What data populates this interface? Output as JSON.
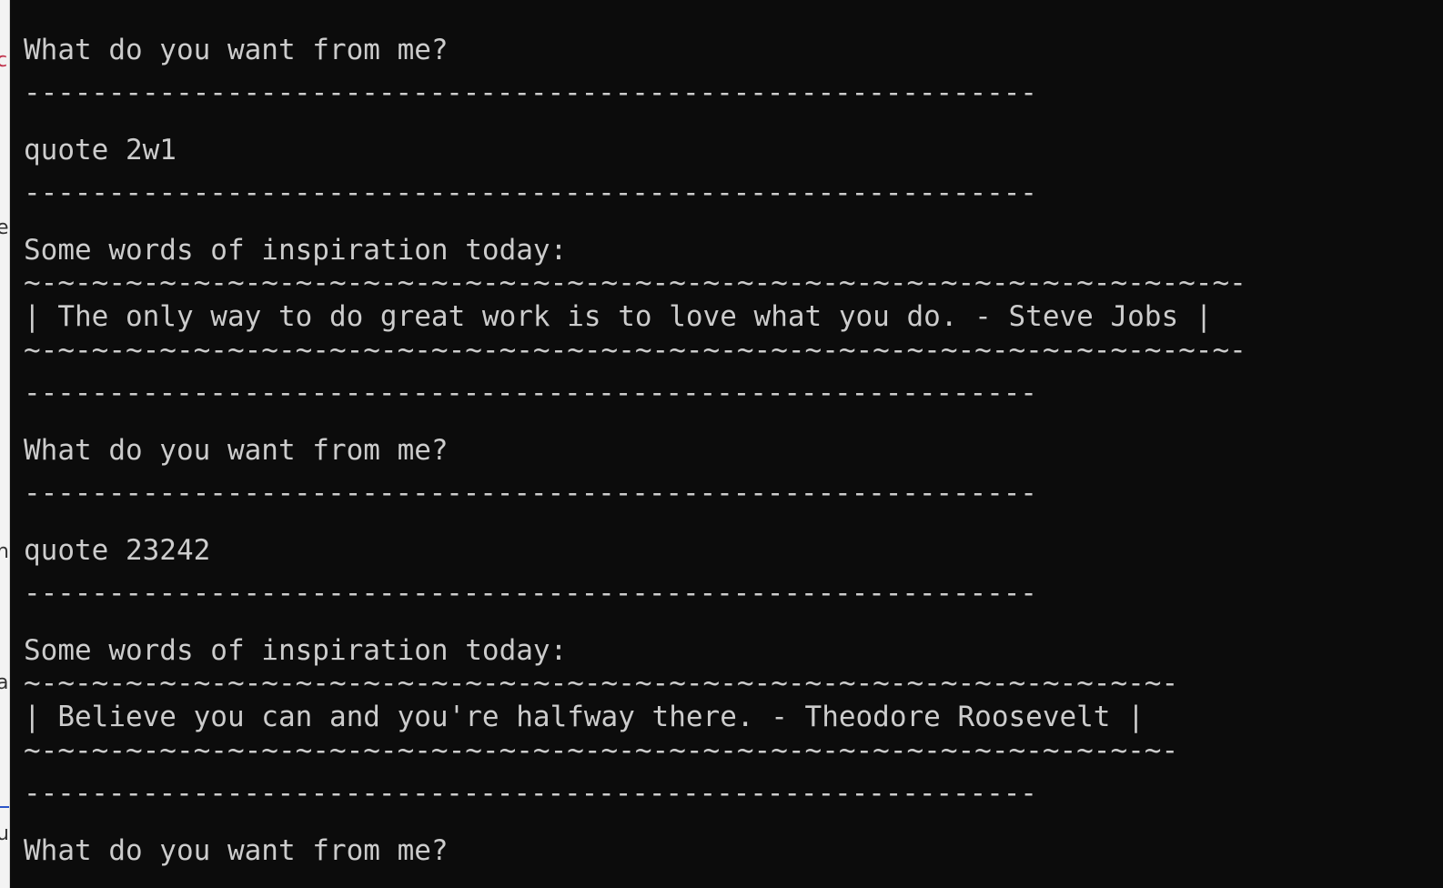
{
  "terminal": {
    "prompt": "What do you want from me?",
    "separator": "------------------------------------------------------------",
    "section_header": "Some words of inspiration today:",
    "exchanges": [
      {
        "command": "quote 2w1",
        "border": "~-~-~-~-~-~-~-~-~-~-~-~-~-~-~-~-~-~-~-~-~-~-~-~-~-~-~-~-~-~-~-~-~-~-~-~-",
        "quote_line": "| The only way to do great work is to love what you do. - Steve Jobs |"
      },
      {
        "command": "quote 23242",
        "border": "~-~-~-~-~-~-~-~-~-~-~-~-~-~-~-~-~-~-~-~-~-~-~-~-~-~-~-~-~-~-~-~-~-~-",
        "quote_line": "| Believe you can and you're halfway there. - Theodore Roosevelt |"
      }
    ]
  },
  "background_window": {
    "fragments": [
      "c",
      "e",
      "n",
      "a",
      "u"
    ]
  },
  "colors": {
    "terminal_background": "#0c0c0c",
    "terminal_text": "#cccccc"
  }
}
